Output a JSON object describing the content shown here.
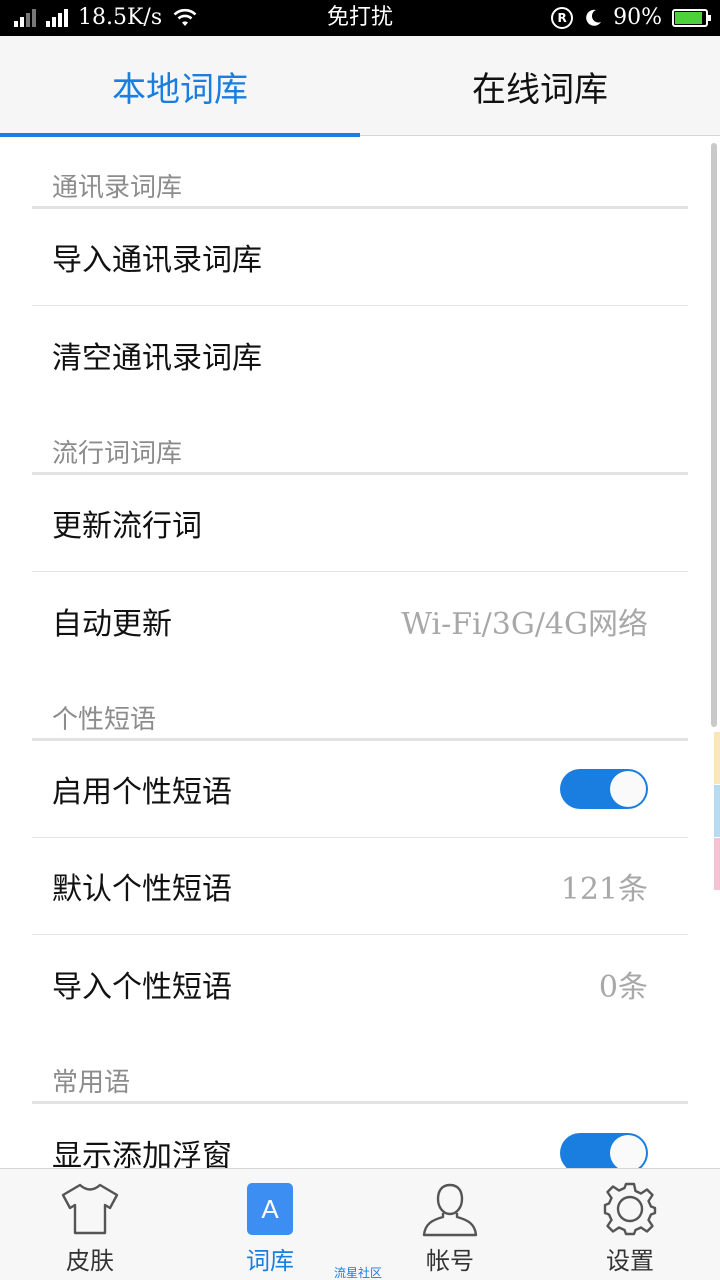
{
  "statusbar": {
    "speed": "18.5K/s",
    "mode": "免打扰",
    "battery_pct": "90%",
    "battery_level": 0.9,
    "icons": [
      "signal-icon",
      "signal-icon",
      "wifi-icon",
      "registered-icon",
      "moon-icon",
      "battery-icon"
    ]
  },
  "tabs": [
    {
      "label": "本地词库",
      "active": true
    },
    {
      "label": "在线词库",
      "active": false
    }
  ],
  "sections": [
    {
      "header": "通讯录词库",
      "rows": [
        {
          "label": "导入通讯录词库"
        },
        {
          "label": "清空通讯录词库"
        }
      ]
    },
    {
      "header": "流行词词库",
      "rows": [
        {
          "label": "更新流行词"
        },
        {
          "label": "自动更新",
          "value": "Wi-Fi/3G/4G网络"
        }
      ]
    },
    {
      "header": "个性短语",
      "rows": [
        {
          "label": "启用个性短语",
          "toggle": true
        },
        {
          "label": "默认个性短语",
          "value": "121条"
        },
        {
          "label": "导入个性短语",
          "value": "0条"
        }
      ]
    },
    {
      "header": "常用语",
      "rows": [
        {
          "label": "显示添加浮窗",
          "toggle": true
        }
      ]
    }
  ],
  "bottomnav": [
    {
      "label": "皮肤",
      "icon": "tshirt-icon"
    },
    {
      "label": "词库",
      "icon": "lexicon-icon",
      "glyph": "A",
      "active": true
    },
    {
      "label": "帐号",
      "icon": "person-icon"
    },
    {
      "label": "设置",
      "icon": "gear-icon"
    }
  ],
  "watermark": "流星社区",
  "colors": {
    "accent": "#1a7ee0",
    "status_bar": "#000000",
    "battery": "#4cd13a",
    "edge_yellow": "#fbe6b6",
    "edge_blue": "#b7dcf2",
    "edge_pink": "#f4c2d2"
  }
}
